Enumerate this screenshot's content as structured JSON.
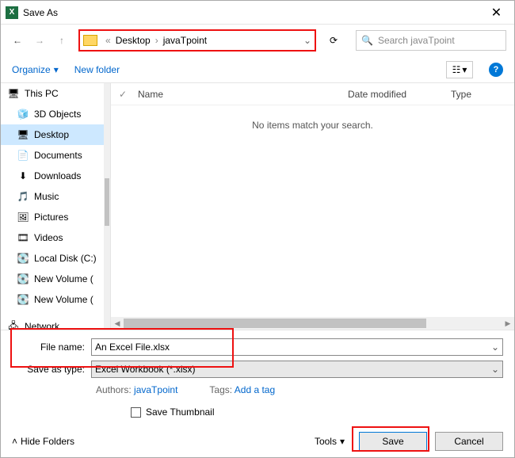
{
  "title": "Save As",
  "breadcrumb": {
    "chev": "«",
    "seg1": "Desktop",
    "seg2": "javaTpoint"
  },
  "search": {
    "placeholder": "Search javaTpoint"
  },
  "toolbar": {
    "organize": "Organize",
    "newfolder": "New folder"
  },
  "columns": {
    "name": "Name",
    "date": "Date modified",
    "type": "Type"
  },
  "empty_message": "No items match your search.",
  "sidebar": {
    "root": "This PC",
    "items": [
      {
        "label": "3D Objects",
        "icon": "🧊"
      },
      {
        "label": "Desktop",
        "icon": "🖥",
        "selected": true
      },
      {
        "label": "Documents",
        "icon": "📄"
      },
      {
        "label": "Downloads",
        "icon": "⬇"
      },
      {
        "label": "Music",
        "icon": "🎵"
      },
      {
        "label": "Pictures",
        "icon": "🖼"
      },
      {
        "label": "Videos",
        "icon": "🎞"
      },
      {
        "label": "Local Disk (C:)",
        "icon": "💽"
      },
      {
        "label": "New Volume (",
        "icon": "💽"
      },
      {
        "label": "New Volume (",
        "icon": "💽"
      }
    ],
    "network": "Network"
  },
  "fields": {
    "filename_label": "File name:",
    "filename_value": "An Excel File.xlsx",
    "savetype_label": "Save as type:",
    "savetype_value": "Excel Workbook (*.xlsx)"
  },
  "meta": {
    "authors_label": "Authors:",
    "authors_value": "javaTpoint",
    "tags_label": "Tags:",
    "tags_value": "Add a tag"
  },
  "save_thumbnail": "Save Thumbnail",
  "hide_folders": "Hide Folders",
  "tools_label": "Tools",
  "buttons": {
    "save": "Save",
    "cancel": "Cancel"
  }
}
